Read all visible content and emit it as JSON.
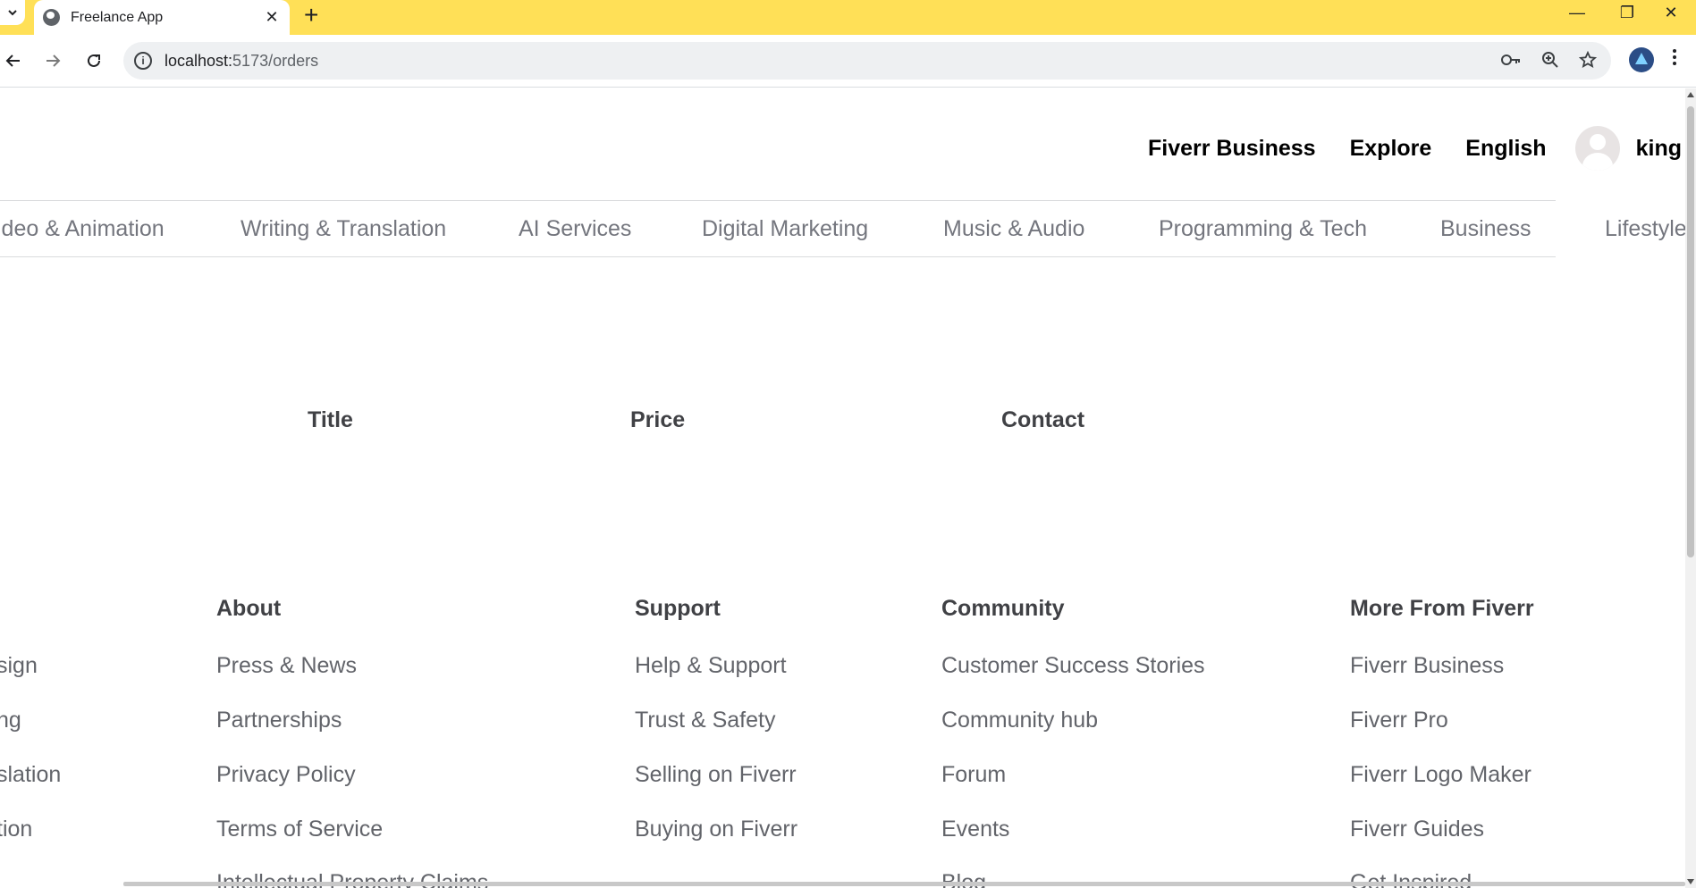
{
  "browser": {
    "tab_title": "Freelance App",
    "new_tab_icon": "+",
    "url_host": "localhost:",
    "url_path": "5173/orders"
  },
  "header": {
    "links": [
      "Fiverr Business",
      "Explore",
      "English"
    ],
    "username": "king"
  },
  "categories": [
    "ideo & Animation",
    "Writing & Translation",
    "AI Services",
    "Digital Marketing",
    "Music & Audio",
    "Programming & Tech",
    "Business",
    "Lifestyle"
  ],
  "orders_table": {
    "headers": [
      "Title",
      "Price",
      "Contact"
    ]
  },
  "footer": {
    "partial_column": [
      "sign",
      "ng",
      "slation",
      "tion"
    ],
    "columns": [
      {
        "title": "About",
        "links": [
          "Press & News",
          "Partnerships",
          "Privacy Policy",
          "Terms of Service",
          "Intellectual Property Claims"
        ]
      },
      {
        "title": "Support",
        "links": [
          "Help & Support",
          "Trust & Safety",
          "Selling on Fiverr",
          "Buying on Fiverr"
        ]
      },
      {
        "title": "Community",
        "links": [
          "Customer Success Stories",
          "Community hub",
          "Forum",
          "Events",
          "Blog"
        ]
      },
      {
        "title": "More From Fiverr",
        "links": [
          "Fiverr Business",
          "Fiverr Pro",
          "Fiverr Logo Maker",
          "Fiverr Guides",
          "Get Inspired"
        ]
      }
    ]
  },
  "colors": {
    "titlebar": "#ffe057",
    "text_dark": "#404145",
    "text_muted": "#74767e"
  }
}
